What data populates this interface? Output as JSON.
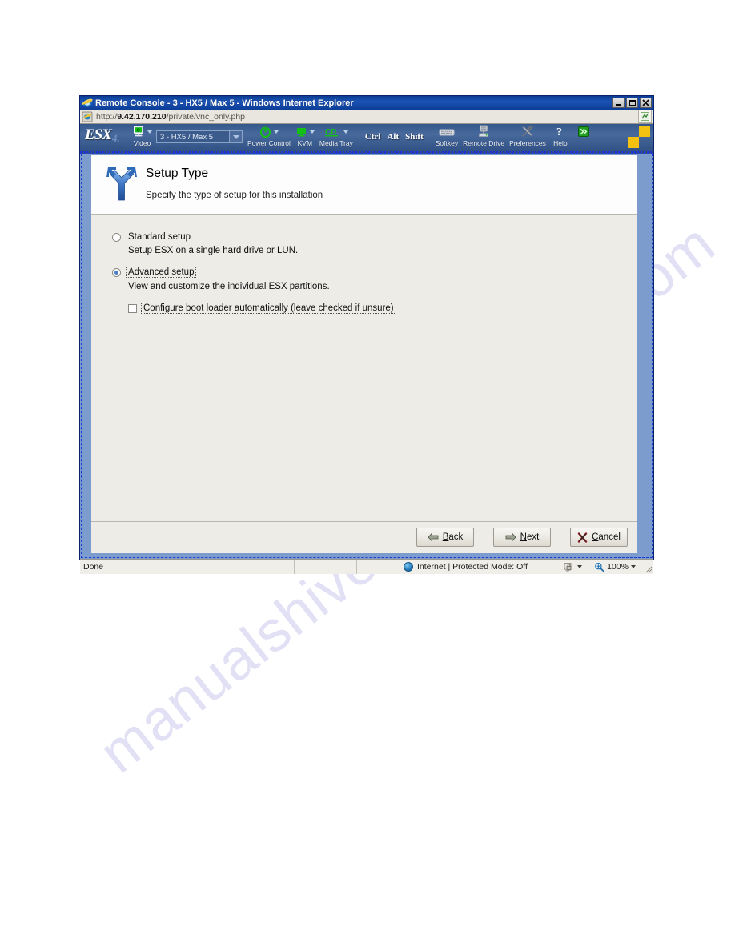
{
  "watermarks": {
    "top": "manualshive.com",
    "bottom": "manualshive.com"
  },
  "browser": {
    "title": "Remote Console - 3 - HX5 / Max 5 - Windows Internet Explorer",
    "window_controls": {
      "minimize": "Minimize",
      "maximize": "Maximize",
      "close": "Close"
    },
    "address": {
      "full": "http://9.42.170.210/private/vnc_only.php",
      "scheme": "http://",
      "host": "9.42.170.210",
      "path": "/private/vnc_only.php"
    }
  },
  "remote_console_toolbar": {
    "logo_text": "ESX",
    "logo_version": "4.",
    "video_label": "Video",
    "video_selected": "3 - HX5 / Max 5",
    "items": [
      {
        "label": "Power Control",
        "icon": "power-icon"
      },
      {
        "label": "KVM",
        "icon": "monitor-icon"
      },
      {
        "label": "Media Tray",
        "icon": "cd-icon"
      }
    ],
    "keys": [
      "Ctrl",
      "Alt",
      "Shift"
    ],
    "tools": [
      {
        "label": "Softkey",
        "icon": "keyboard-icon"
      },
      {
        "label": "Remote Drive",
        "icon": "drive-icon"
      },
      {
        "label": "Preferences",
        "icon": "tools-icon"
      },
      {
        "label": "Help",
        "icon": "question-icon"
      }
    ],
    "expand_label": "Expand"
  },
  "dialog": {
    "title": "Setup Type",
    "subtitle": "Specify the type of setup for this installation",
    "header_icon": "fork-branch-icon",
    "options": [
      {
        "label": "Standard setup",
        "description": "Setup ESX on a single hard drive or LUN.",
        "selected": false
      },
      {
        "label": "Advanced setup",
        "description": "View and customize the individual ESX partitions.",
        "selected": true
      }
    ],
    "checkbox": {
      "label": "Configure boot loader automatically (leave checked if unsure)",
      "checked": false
    },
    "buttons": {
      "back": {
        "pre": "",
        "accel": "B",
        "post": "ack",
        "icon": "arrow-left-icon"
      },
      "next": {
        "pre": "",
        "accel": "N",
        "post": "ext",
        "icon": "arrow-right-icon"
      },
      "cancel": {
        "pre": "",
        "accel": "C",
        "post": "ancel",
        "icon": "x-mark-icon"
      }
    }
  },
  "statusbar": {
    "status": "Done",
    "zone": "Internet | Protected Mode: Off",
    "zoom": "100%"
  },
  "colors": {
    "titlebar": "#0a3d91",
    "toolbar": "#3b5c90",
    "vnc_border": "#7b9ccd",
    "focus_dash": "#1b3bd4",
    "dialog_bg": "#eeece7",
    "accent_yellow": "#f3c211",
    "icon_green": "#13c113",
    "radio_dot": "#4a7fc8"
  }
}
